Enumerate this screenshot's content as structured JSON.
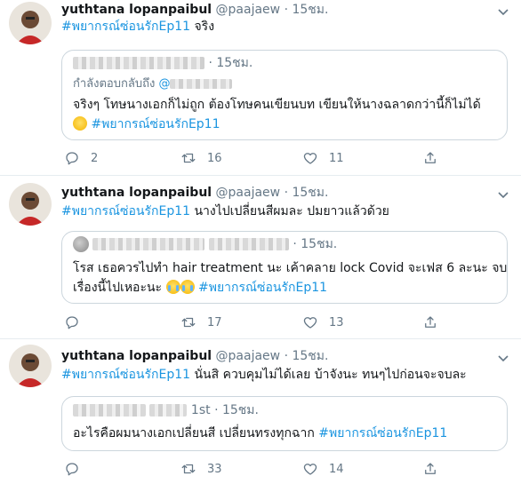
{
  "tweets": [
    {
      "name": "yuthtana lopanpaibul",
      "handle": "@paajaew",
      "dot": "·",
      "time": "15ชม.",
      "hashtag": "#พยากรณ์ซ่อนรักEp11",
      "text": " จริง",
      "quote": {
        "dot": "·",
        "time": "15ชม.",
        "reply_prefix": "กำลังตอบกลับถึง",
        "reply_mention": "@",
        "line1": "จริงๆ โทษนางเอกก็ไม่ถูก ต้องโทษคนเขียนบท เขียนให้นางฉลาดกว่านี้ก็ไม่ได้",
        "line2_hashtag": "#พยากรณ์ซ่อนรักEp11"
      },
      "counts": {
        "reply": "2",
        "retweet": "16",
        "like": "11"
      }
    },
    {
      "name": "yuthtana lopanpaibul",
      "handle": "@paajaew",
      "dot": "·",
      "time": "15ชม.",
      "hashtag": "#พยากรณ์ซ่อนรักEp11",
      "text": " นางไปเปลี่ยนสีผมละ ปมยาวแล้วด้วย",
      "quote": {
        "dot": "·",
        "time": "15ชม.",
        "line1": "โรส เธอควรไปทำ hair treatment นะ เค้าคลาย lock Covid จะเฟส 6 ละนะ จบ",
        "line2_text": "เรื่องนี้ไปเหอะนะ",
        "line2_hashtag": "#พยากรณ์ซ่อนรักEp11"
      },
      "counts": {
        "reply": "",
        "retweet": "17",
        "like": "13"
      }
    },
    {
      "name": "yuthtana lopanpaibul",
      "handle": "@paajaew",
      "dot": "·",
      "time": "15ชม.",
      "hashtag": "#พยากรณ์ซ่อนรักEp11",
      "text": " นั่นสิ ควบคุมไม่ได้เลย บ้าจังนะ  ทนๆไปก่อนจะจบละ",
      "quote": {
        "mid": "1st",
        "dot": "·",
        "time": "15ชม.",
        "line1_text": "อะไรคือผมนางเอกเปลี่ยนสี เปลี่ยนทรงทุกฉาก ",
        "line1_hashtag": "#พยากรณ์ซ่อนรักEp11"
      },
      "counts": {
        "reply": "",
        "retweet": "33",
        "like": "14"
      }
    }
  ]
}
